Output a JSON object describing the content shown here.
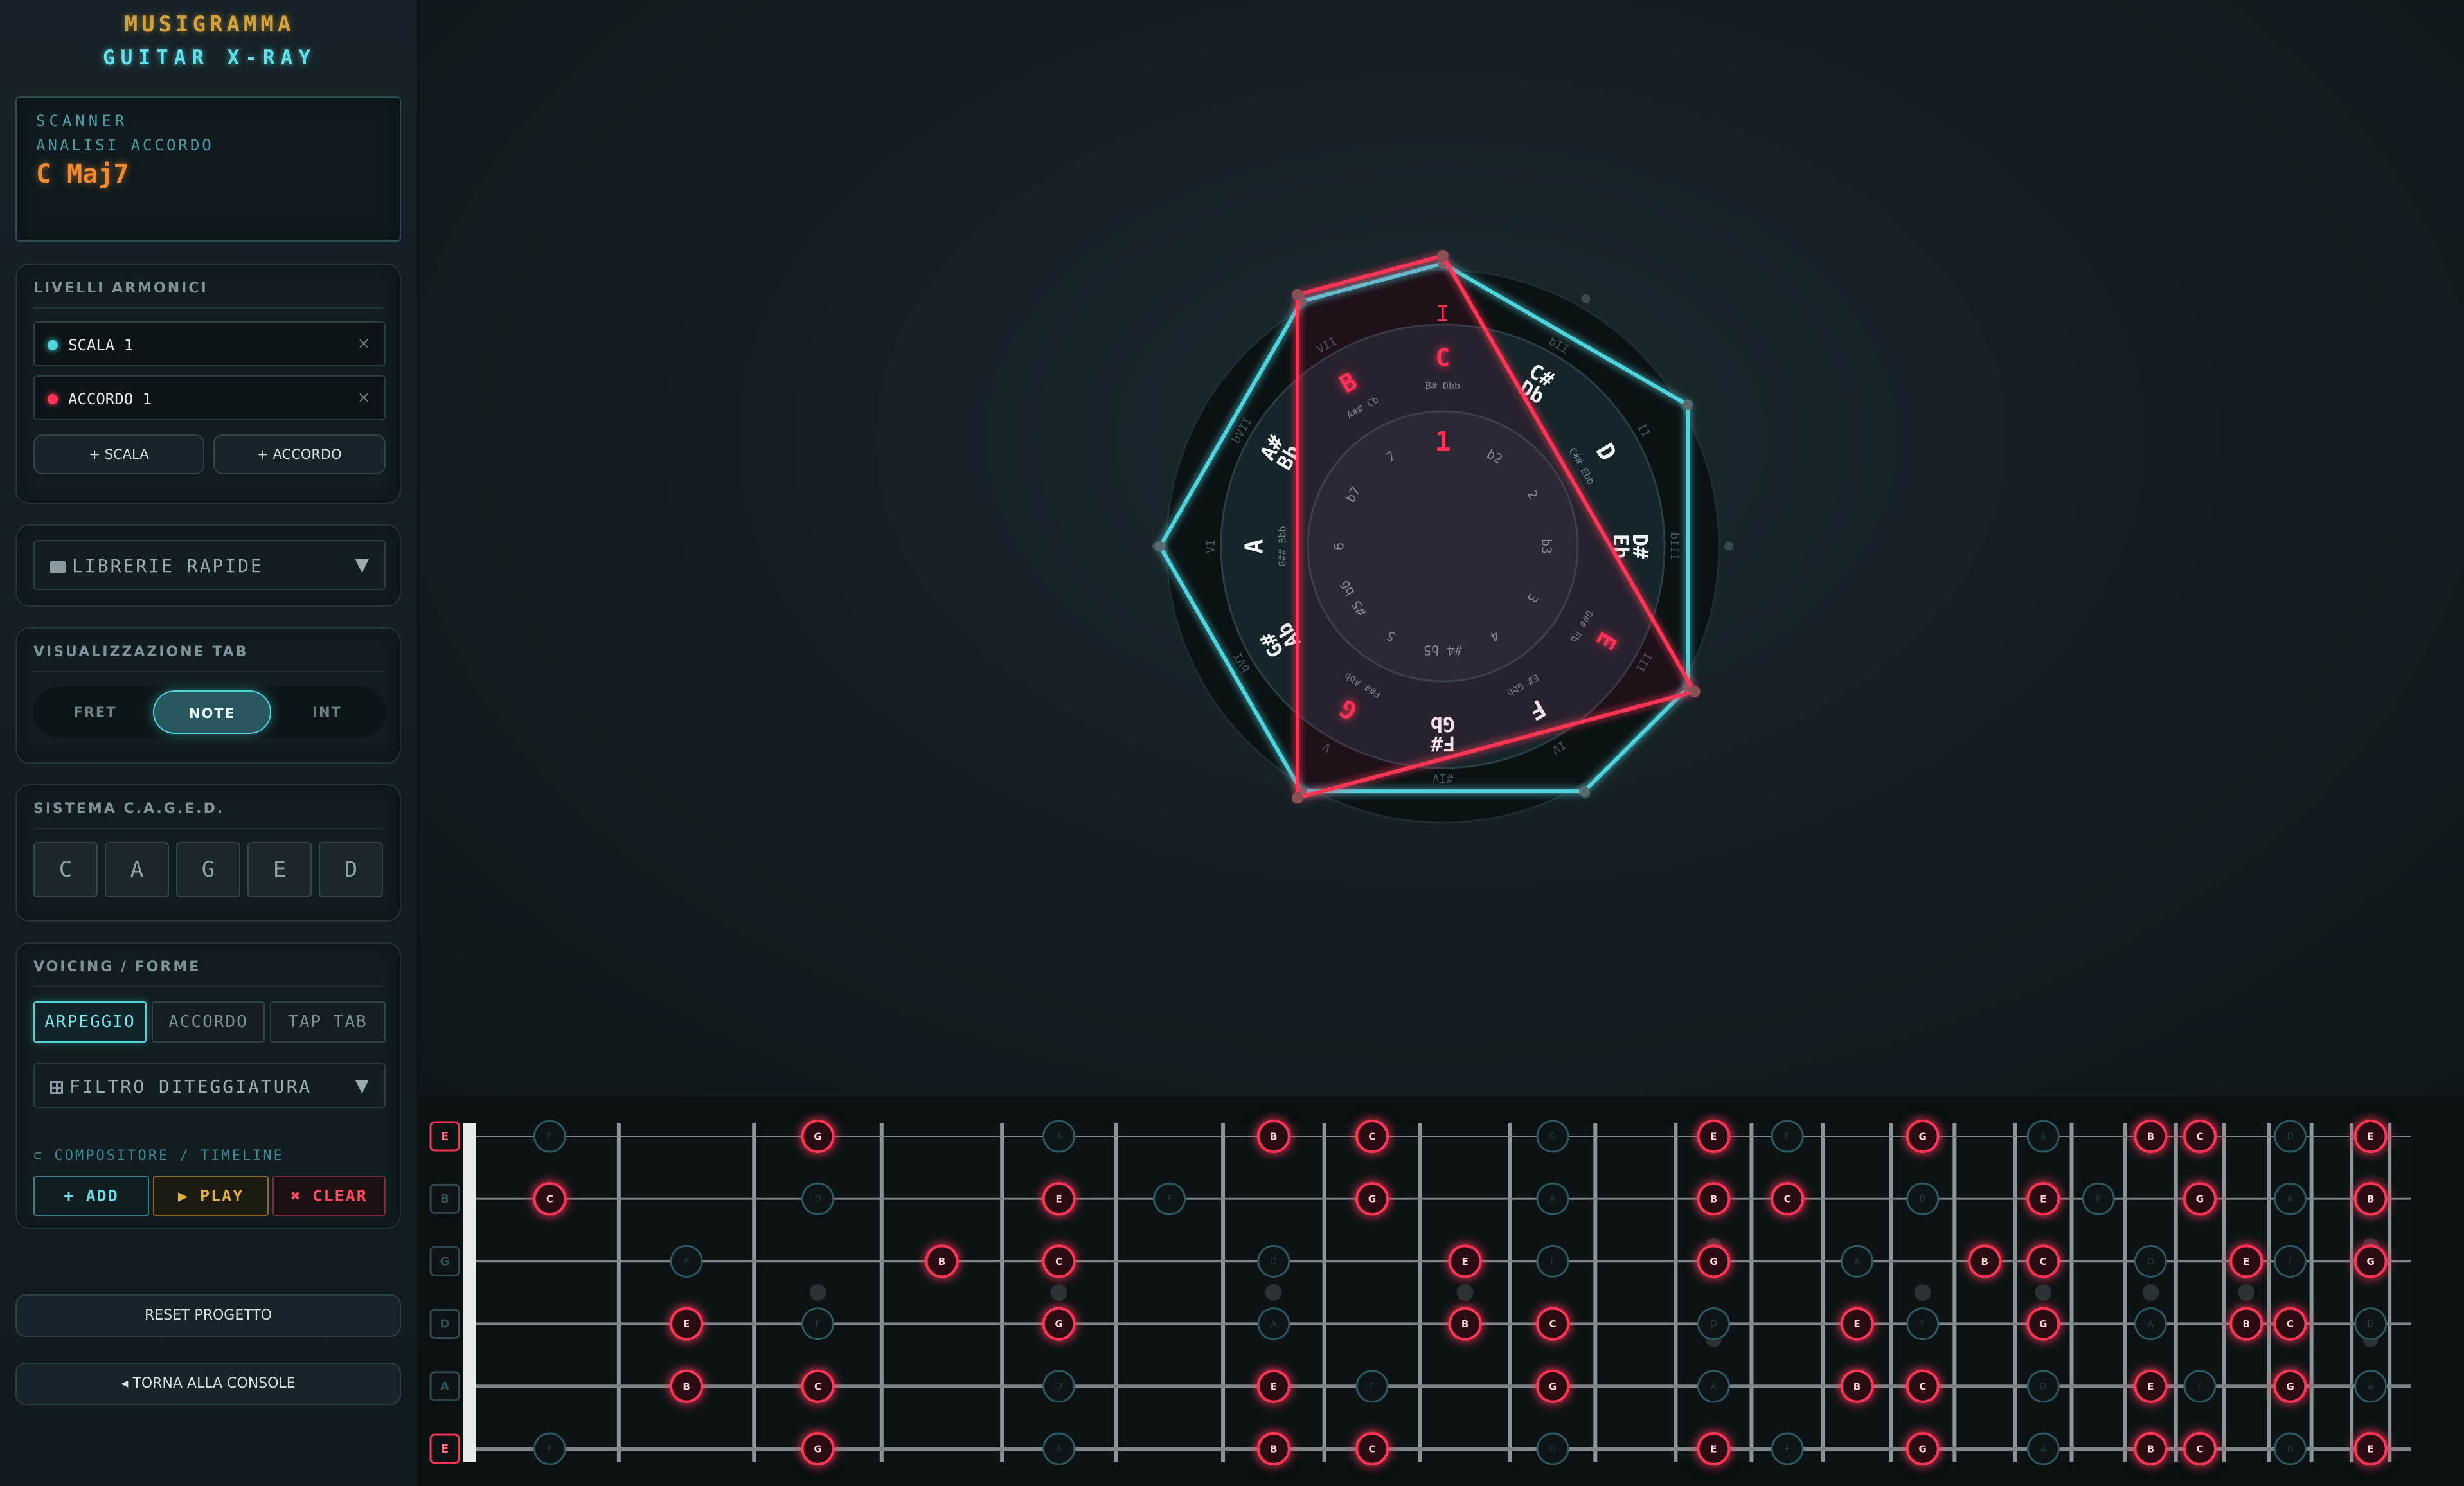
{
  "app": {
    "brand": "MUSIGRAMMA",
    "subtitle": "GUITAR X-RAY"
  },
  "colors": {
    "scale": "#4fd3dd",
    "chord": "#ff3456",
    "accent": "#f08a2c",
    "play": "#e0b040"
  },
  "scanner": {
    "label": "SCANNER",
    "sublabel": "ANALISI ACCORDO",
    "chord": "C Maj7"
  },
  "layers": {
    "title": "LIVELLI ARMONICI",
    "items": [
      {
        "label": "SCALA 1",
        "color": "#4fd3dd",
        "remove": "×"
      },
      {
        "label": "ACCORDO 1",
        "color": "#ff3456",
        "remove": "×"
      }
    ],
    "add_scale": "+ SCALA",
    "add_chord": "+ ACCORDO"
  },
  "library": {
    "icon": "folder-icon",
    "label": "LIBRERIE RAPIDE",
    "arrow": "▼"
  },
  "tab_view": {
    "title": "VISUALIZZAZIONE TAB",
    "options": [
      "FRET",
      "NOTE",
      "INT"
    ],
    "selected": "NOTE"
  },
  "caged": {
    "title": "SISTEMA C.A.G.E.D.",
    "shapes": [
      "C",
      "A",
      "G",
      "E",
      "D"
    ]
  },
  "voicing": {
    "title": "VOICING / FORME",
    "options": [
      "ARPEGGIO",
      "ACCORDO",
      "TAP TAB"
    ],
    "selected": "ARPEGGIO",
    "filter": "FILTRO DITEGGIATURA",
    "filter_arrow": "▼",
    "composer": "COMPOSITORE / TIMELINE",
    "add": "+ ADD",
    "play": "PLAY",
    "clear": "CLEAR"
  },
  "footer": {
    "reset": "RESET PROGETTO",
    "back": "◂ TORNA ALLA CONSOLE"
  },
  "wheel": {
    "degree_center": "1",
    "inner_intervals": [
      "1",
      "b2",
      "2",
      "b3",
      "3",
      "4",
      "#4 b5",
      "5",
      "#5 b6",
      "6",
      "b7",
      "7"
    ],
    "notes": [
      {
        "name": "C",
        "alt": "B# Dbb",
        "chord": true
      },
      {
        "name": "C# Db",
        "alt": "",
        "chord": false
      },
      {
        "name": "D",
        "alt": "C## Ebb",
        "chord": false
      },
      {
        "name": "D# Eb",
        "alt": "",
        "chord": false
      },
      {
        "name": "E",
        "alt": "D## Fb",
        "chord": true
      },
      {
        "name": "F",
        "alt": "E# Gbb",
        "chord": false
      },
      {
        "name": "F# Gb",
        "alt": "",
        "chord": false
      },
      {
        "name": "G",
        "alt": "F## Abb",
        "chord": true
      },
      {
        "name": "G# Ab",
        "alt": "",
        "chord": false
      },
      {
        "name": "A",
        "alt": "G## Bbb",
        "chord": false
      },
      {
        "name": "A# Bb",
        "alt": "",
        "chord": false
      },
      {
        "name": "B",
        "alt": "A## Cb",
        "chord": true
      }
    ],
    "roman": [
      "I",
      "bII",
      "II",
      "bIII",
      "III",
      "IV",
      "#IV",
      "V",
      "bVI",
      "VI",
      "bVII",
      "VII"
    ],
    "scale_pcs": [
      0,
      2,
      4,
      5,
      7,
      9,
      11
    ],
    "chord_pcs": [
      0,
      4,
      7,
      11
    ]
  },
  "fretboard": {
    "strings": [
      "E",
      "B",
      "G",
      "D",
      "A",
      "E"
    ],
    "string_open_pc": [
      4,
      11,
      7,
      2,
      9,
      4
    ],
    "frets": 24,
    "pc_names": [
      "C",
      "C#",
      "D",
      "D#",
      "E",
      "F",
      "F#",
      "G",
      "G#",
      "A",
      "A#",
      "B"
    ],
    "scale_pcs": [
      0,
      2,
      4,
      5,
      7,
      9,
      11
    ],
    "chord_pcs": [
      0,
      4,
      7,
      11
    ]
  }
}
